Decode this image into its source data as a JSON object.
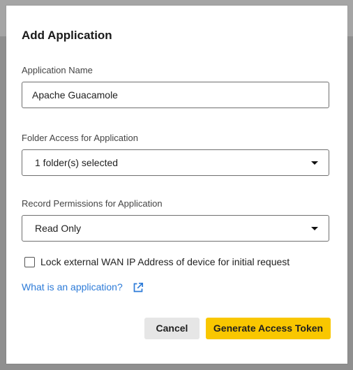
{
  "dialog": {
    "title": "Add Application"
  },
  "form": {
    "app_name": {
      "label": "Application Name",
      "value": "Apache Guacamole"
    },
    "folder_access": {
      "label": "Folder Access for Application",
      "selected": "1 folder(s) selected"
    },
    "record_permissions": {
      "label": "Record Permissions for Application",
      "selected": "Read Only"
    },
    "lock_ip": {
      "label": "Lock external WAN IP Address of device for initial request",
      "checked": false
    }
  },
  "help": {
    "link_text": "What is an application?",
    "icon": "external-link-icon"
  },
  "actions": {
    "cancel_label": "Cancel",
    "generate_label": "Generate Access Token"
  },
  "colors": {
    "accent_button": "#f9c700",
    "link": "#2d7bd8",
    "overlay": "#8f8f8f"
  }
}
